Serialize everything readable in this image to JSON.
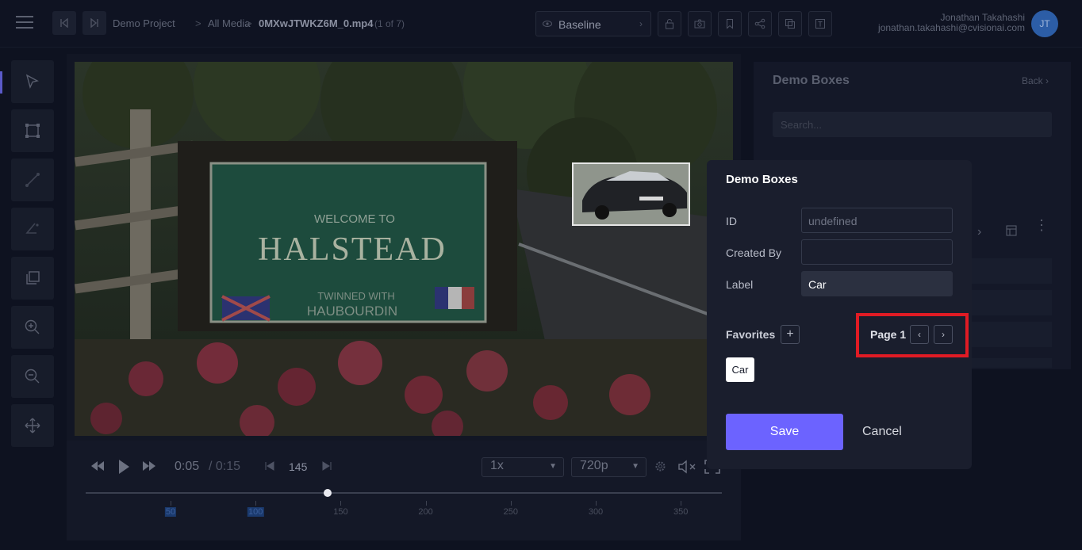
{
  "breadcrumb": {
    "project": "Demo Project",
    "media": "All Media",
    "file": "0MXwJTWKZ6M_0.mp4",
    "count": "(1 of 7)",
    "separator": ">"
  },
  "toolbar": {
    "baseline_label": "Baseline"
  },
  "user": {
    "name": "Jonathan Takahashi",
    "email": "jonathan.takahashi@cvisionai.com",
    "initials": "JT"
  },
  "player": {
    "current_time": "0:05",
    "total_time": "/ 0:15",
    "frame": "145",
    "speed": "1x",
    "quality": "720p",
    "progress_fraction": 0.38,
    "timeline_labels": [
      "50",
      "100",
      "150",
      "200",
      "250",
      "300",
      "350"
    ]
  },
  "right_panel": {
    "title": "Demo Boxes",
    "back": "Back",
    "search_placeholder": "Search..."
  },
  "dialog": {
    "title": "Demo Boxes",
    "id_label": "ID",
    "id_placeholder": "undefined",
    "created_by_label": "Created By",
    "created_by_value": "",
    "label_label": "Label",
    "label_value": "Car",
    "favorites_label": "Favorites",
    "page_label": "Page 1",
    "favorite_chip": "Car",
    "save_label": "Save",
    "cancel_label": "Cancel"
  },
  "scene": {
    "sign_line1": "WELCOME TO",
    "sign_line2": "HALSTEAD",
    "sign_line3": "TWINNED WITH",
    "sign_line4": "HAUBOURDIN"
  },
  "colors": {
    "accent": "#6c63ff",
    "highlight": "#e01b24",
    "avatar": "#2c5da6"
  }
}
